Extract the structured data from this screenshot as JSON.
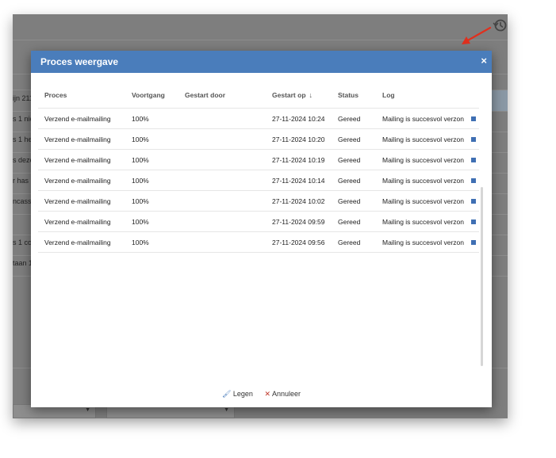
{
  "background": {
    "text_fragments": [
      "ijn 211",
      "s 1 nie",
      "s 1 hel",
      "s deze",
      "r has",
      "ncass",
      "s 1 coll",
      "taan 1"
    ]
  },
  "modal": {
    "title": "Proces weergave",
    "close_label": "×",
    "columns": {
      "proces": "Proces",
      "voortgang": "Voortgang",
      "gestart_door": "Gestart door",
      "gestart_op": "Gestart op",
      "status": "Status",
      "log": "Log"
    },
    "sort_indicator": "↓",
    "rows": [
      {
        "proces": "Verzend e-mailmailing",
        "voortgang": "100%",
        "gestart_door": "",
        "gestart_op": "27-11-2024 10:24",
        "status": "Gereed",
        "log": "Mailing is succesvol verzon"
      },
      {
        "proces": "Verzend e-mailmailing",
        "voortgang": "100%",
        "gestart_door": "",
        "gestart_op": "27-11-2024 10:20",
        "status": "Gereed",
        "log": "Mailing is succesvol verzon"
      },
      {
        "proces": "Verzend e-mailmailing",
        "voortgang": "100%",
        "gestart_door": "",
        "gestart_op": "27-11-2024 10:19",
        "status": "Gereed",
        "log": "Mailing is succesvol verzon"
      },
      {
        "proces": "Verzend e-mailmailing",
        "voortgang": "100%",
        "gestart_door": "",
        "gestart_op": "27-11-2024 10:14",
        "status": "Gereed",
        "log": "Mailing is succesvol verzon"
      },
      {
        "proces": "Verzend e-mailmailing",
        "voortgang": "100%",
        "gestart_door": "",
        "gestart_op": "27-11-2024 10:02",
        "status": "Gereed",
        "log": "Mailing is succesvol verzon"
      },
      {
        "proces": "Verzend e-mailmailing",
        "voortgang": "100%",
        "gestart_door": "",
        "gestart_op": "27-11-2024 09:59",
        "status": "Gereed",
        "log": "Mailing is succesvol verzon"
      },
      {
        "proces": "Verzend e-mailmailing",
        "voortgang": "100%",
        "gestart_door": "",
        "gestart_op": "27-11-2024 09:56",
        "status": "Gereed",
        "log": "Mailing is succesvol verzon"
      }
    ],
    "footer": {
      "clear_label": "Legen",
      "cancel_label": "Annuleer"
    }
  },
  "colors": {
    "header": "#4a7dbb",
    "log_icon": "#3f6fb3",
    "arrow": "#e0301e"
  }
}
